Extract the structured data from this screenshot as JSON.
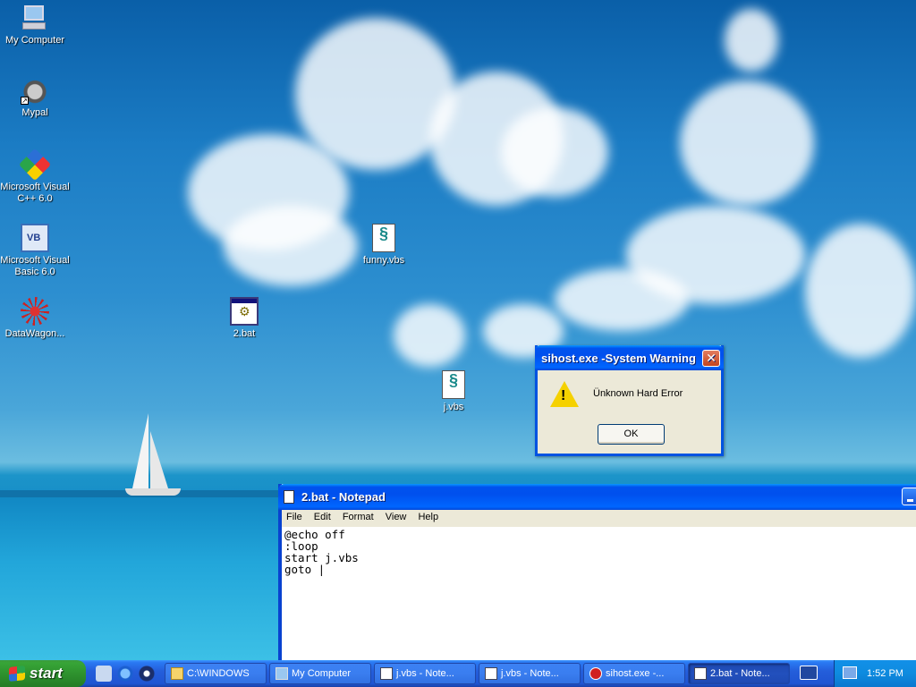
{
  "desktop": {
    "icons": [
      {
        "label": "My Computer",
        "icon": "my-computer-icon"
      },
      {
        "label": "Mypal",
        "icon": "mypal-icon"
      },
      {
        "label": "Microsoft Visual C++ 6.0",
        "icon": "visual-cpp-icon"
      },
      {
        "label": "Microsoft Visual Basic 6.0",
        "icon": "visual-basic-icon"
      },
      {
        "label": "DataWagon...",
        "icon": "datawagon-icon"
      },
      {
        "label": "2.bat",
        "icon": "batch-file-icon"
      },
      {
        "label": "funny.vbs",
        "icon": "vbs-script-icon"
      },
      {
        "label": "j.vbs",
        "icon": "vbs-script-icon"
      }
    ]
  },
  "dialog": {
    "title": "sihost.exe -System Warning",
    "message": "Ünknown Hard Error",
    "ok_label": "OK",
    "close_glyph": "✕",
    "icon": "warning-icon"
  },
  "notepad": {
    "title": "2.bat - Notepad",
    "menu": [
      "File",
      "Edit",
      "Format",
      "View",
      "Help"
    ],
    "content": "@echo off\n:loop\nstart j.vbs\ngoto |"
  },
  "taskbar": {
    "start_label": "start",
    "tasks": [
      {
        "label": "C:\\WINDOWS",
        "icon": "folder-icon",
        "active": false
      },
      {
        "label": "My Computer",
        "icon": "my-computer-icon",
        "active": false
      },
      {
        "label": "j.vbs - Note...",
        "icon": "notepad-icon",
        "active": false
      },
      {
        "label": "j.vbs - Note...",
        "icon": "notepad-icon",
        "active": false
      },
      {
        "label": "sihost.exe -...",
        "icon": "error-app-icon",
        "active": false
      },
      {
        "label": "2.bat - Note...",
        "icon": "notepad-icon",
        "active": true
      }
    ],
    "clock": "1:52 PM"
  },
  "colors": {
    "xp_blue": "#0053ee",
    "start_green": "#2e922e",
    "dialog_bg": "#ece9d8"
  }
}
